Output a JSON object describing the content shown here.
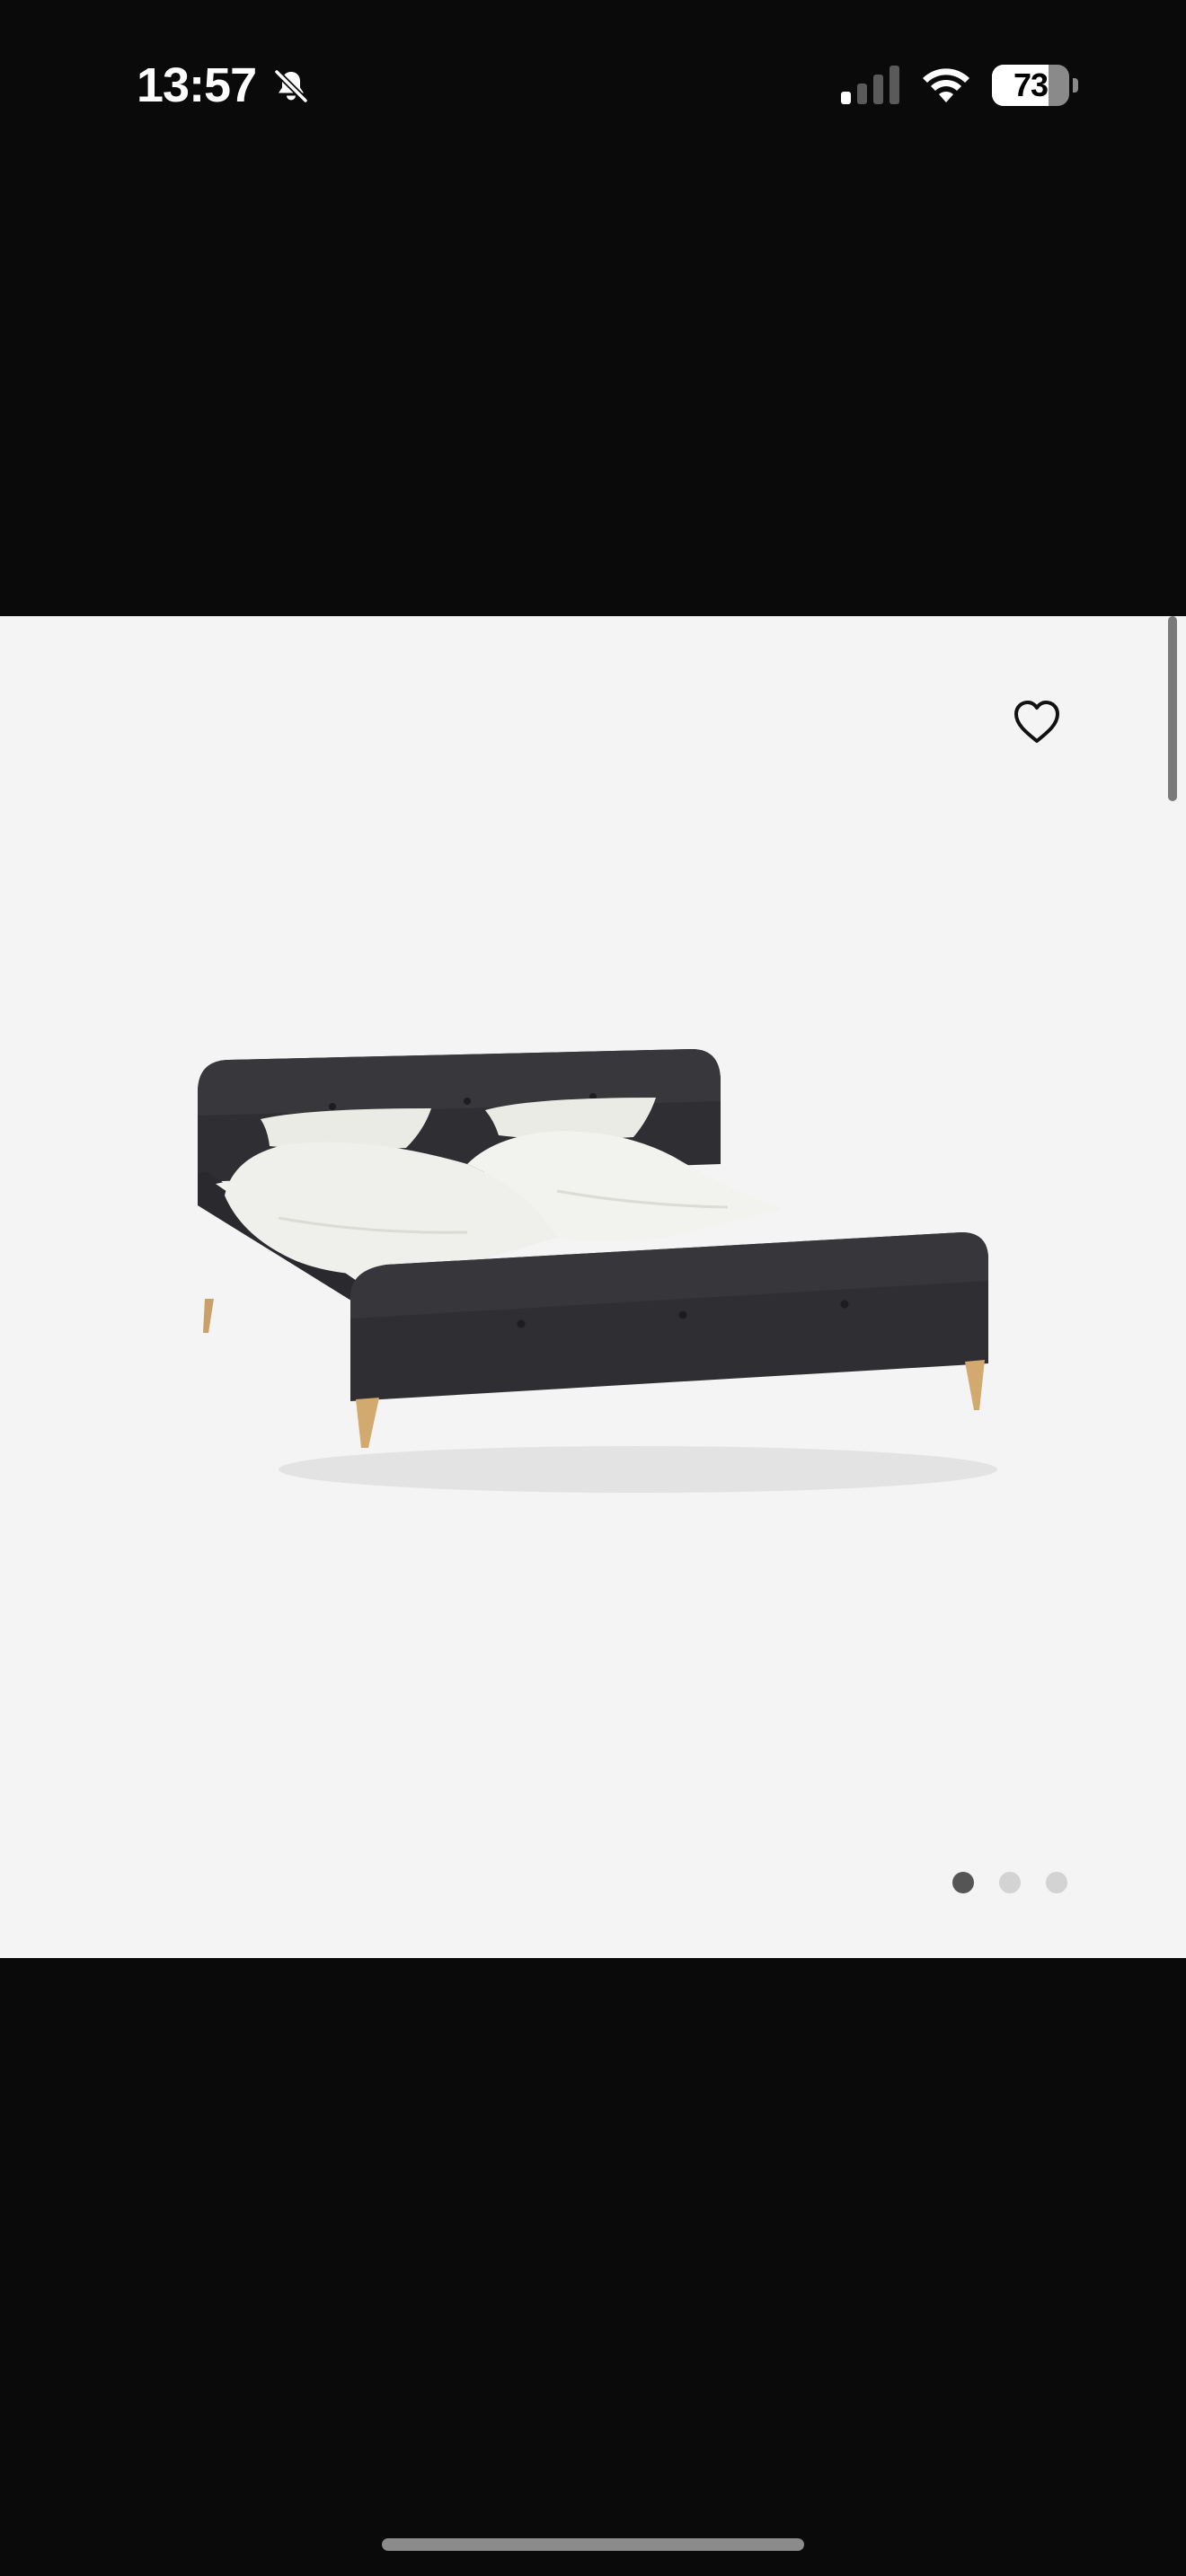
{
  "status_bar": {
    "time": "13:57",
    "battery_level": "73",
    "battery_percent": 73,
    "icons": [
      "bell-slash-icon",
      "cellular-signal-icon",
      "wifi-icon",
      "battery-icon"
    ]
  },
  "gallery": {
    "favorite_icon": "heart-outline-icon",
    "image": "bed-product-image",
    "page_count": 3,
    "active_page": 1
  },
  "colors": {
    "background": "#0a0a0a",
    "gallery_background": "#f4f4f4",
    "dot_active": "#555555",
    "dot_inactive": "#d3d3d3"
  }
}
